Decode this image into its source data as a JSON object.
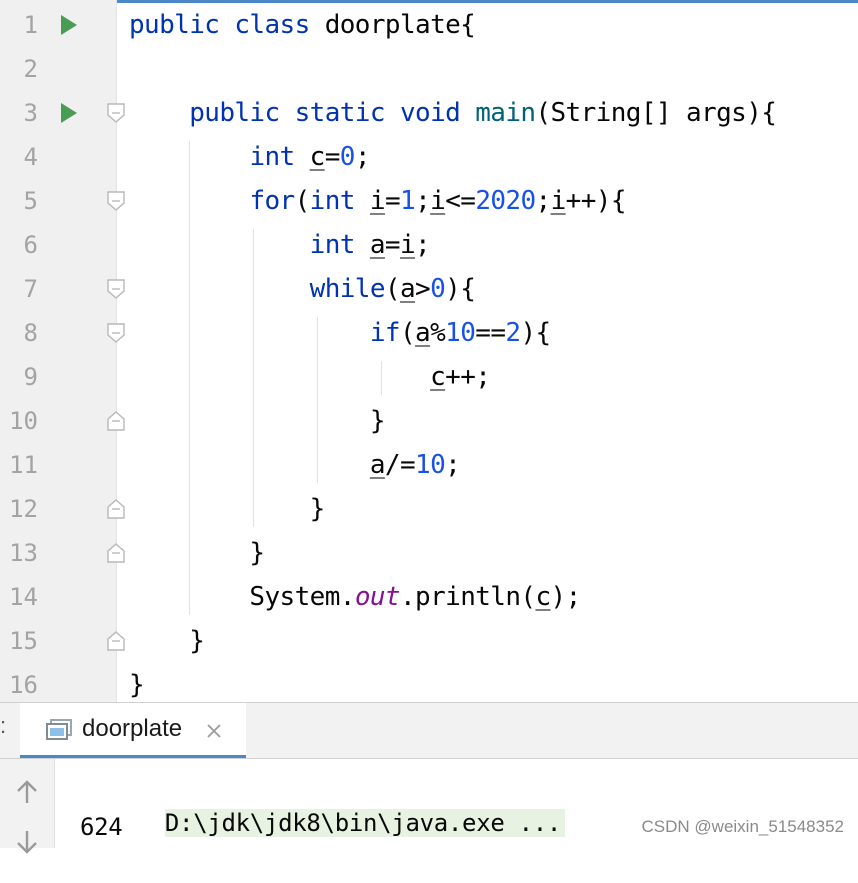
{
  "editor": {
    "line_numbers": [
      "1",
      "2",
      "3",
      "4",
      "5",
      "6",
      "7",
      "8",
      "9",
      "10",
      "11",
      "12",
      "13",
      "14",
      "15",
      "16"
    ],
    "lines": [
      [
        {
          "t": "public class ",
          "c": "kw"
        },
        {
          "t": "doorplate{",
          "c": ""
        }
      ],
      [],
      [
        {
          "t": "    ",
          "c": ""
        },
        {
          "t": "public static void ",
          "c": "kw"
        },
        {
          "t": "main",
          "c": "fn"
        },
        {
          "t": "(String[] args){",
          "c": ""
        }
      ],
      [
        {
          "t": "        ",
          "c": ""
        },
        {
          "t": "int ",
          "c": "kw"
        },
        {
          "t": "c",
          "c": "var"
        },
        {
          "t": "=",
          "c": ""
        },
        {
          "t": "0",
          "c": "num"
        },
        {
          "t": ";",
          "c": ""
        }
      ],
      [
        {
          "t": "        ",
          "c": ""
        },
        {
          "t": "for",
          "c": "kw"
        },
        {
          "t": "(",
          "c": ""
        },
        {
          "t": "int ",
          "c": "kw"
        },
        {
          "t": "i",
          "c": "var"
        },
        {
          "t": "=",
          "c": ""
        },
        {
          "t": "1",
          "c": "num"
        },
        {
          "t": ";",
          "c": ""
        },
        {
          "t": "i",
          "c": "var"
        },
        {
          "t": "<=",
          "c": ""
        },
        {
          "t": "2020",
          "c": "num"
        },
        {
          "t": ";",
          "c": ""
        },
        {
          "t": "i",
          "c": "var"
        },
        {
          "t": "++){",
          "c": ""
        }
      ],
      [
        {
          "t": "            ",
          "c": ""
        },
        {
          "t": "int ",
          "c": "kw"
        },
        {
          "t": "a",
          "c": "var"
        },
        {
          "t": "=",
          "c": ""
        },
        {
          "t": "i",
          "c": "var"
        },
        {
          "t": ";",
          "c": ""
        }
      ],
      [
        {
          "t": "            ",
          "c": ""
        },
        {
          "t": "while",
          "c": "kw"
        },
        {
          "t": "(",
          "c": ""
        },
        {
          "t": "a",
          "c": "var"
        },
        {
          "t": ">",
          "c": ""
        },
        {
          "t": "0",
          "c": "num"
        },
        {
          "t": "){",
          "c": ""
        }
      ],
      [
        {
          "t": "                ",
          "c": ""
        },
        {
          "t": "if",
          "c": "kw"
        },
        {
          "t": "(",
          "c": ""
        },
        {
          "t": "a",
          "c": "var"
        },
        {
          "t": "%",
          "c": ""
        },
        {
          "t": "10",
          "c": "num"
        },
        {
          "t": "==",
          "c": ""
        },
        {
          "t": "2",
          "c": "num"
        },
        {
          "t": "){",
          "c": ""
        }
      ],
      [
        {
          "t": "                    ",
          "c": ""
        },
        {
          "t": "c",
          "c": "var"
        },
        {
          "t": "++;",
          "c": ""
        }
      ],
      [
        {
          "t": "                }",
          "c": ""
        }
      ],
      [
        {
          "t": "                ",
          "c": ""
        },
        {
          "t": "a",
          "c": "var"
        },
        {
          "t": "/=",
          "c": ""
        },
        {
          "t": "10",
          "c": "num"
        },
        {
          "t": ";",
          "c": ""
        }
      ],
      [
        {
          "t": "            }",
          "c": ""
        }
      ],
      [
        {
          "t": "        }",
          "c": ""
        }
      ],
      [
        {
          "t": "        System.",
          "c": ""
        },
        {
          "t": "out",
          "c": "fld"
        },
        {
          "t": ".println(",
          "c": ""
        },
        {
          "t": "c",
          "c": "var"
        },
        {
          "t": ");",
          "c": ""
        }
      ],
      [
        {
          "t": "    }",
          "c": ""
        }
      ],
      [
        {
          "t": "}",
          "c": ""
        }
      ]
    ],
    "run_markers": [
      1,
      3
    ],
    "fold_open": [
      3,
      5,
      7,
      8
    ],
    "fold_close": [
      10,
      12,
      13,
      15
    ]
  },
  "run_panel": {
    "colon": ":",
    "tab_label": "doorplate",
    "console_lines": [
      "D:\\jdk\\jdk8\\bin\\java.exe ...",
      "624"
    ]
  },
  "watermark": "CSDN @weixin_51548352",
  "colors": {
    "keyword": "#0033b3",
    "number": "#1750eb",
    "method": "#00627a",
    "static_field": "#871094",
    "run_icon": "#499c54",
    "command_bg": "#e8f2e2"
  },
  "icons": [
    "run-gutter-icon",
    "fold-icon",
    "unfold-icon",
    "console-tab-icon",
    "close-icon",
    "arrow-up-icon",
    "arrow-down-icon"
  ]
}
